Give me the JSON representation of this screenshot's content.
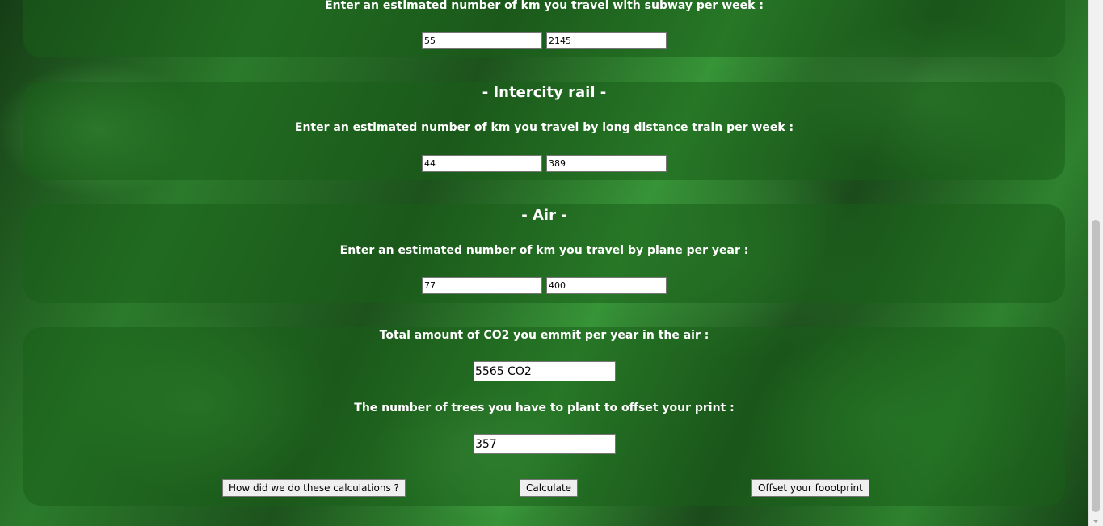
{
  "subway": {
    "label": "Enter an estimated number of km you travel with subway per week :",
    "input_a": "55",
    "input_b": "2145"
  },
  "intercity": {
    "title": "- Intercity rail -",
    "label": "Enter an estimated number of km you travel by long distance train per week :",
    "input_a": "44",
    "input_b": "389"
  },
  "air": {
    "title": "- Air -",
    "label": "Enter an estimated number of km you travel by plane per year :",
    "input_a": "77",
    "input_b": "400"
  },
  "totals": {
    "co2_label": "Total amount of CO2 you emmit per year in the air :",
    "co2_value": "5565 CO2",
    "trees_label": "The number of trees you have to plant to offset your print :",
    "trees_value": "357"
  },
  "buttons": {
    "how": "How did we do these calculations ?",
    "calculate": "Calculate",
    "offset": "Offset your foootprint"
  },
  "colors": {
    "panel": "#1f5f1f",
    "text": "#ffffff"
  }
}
